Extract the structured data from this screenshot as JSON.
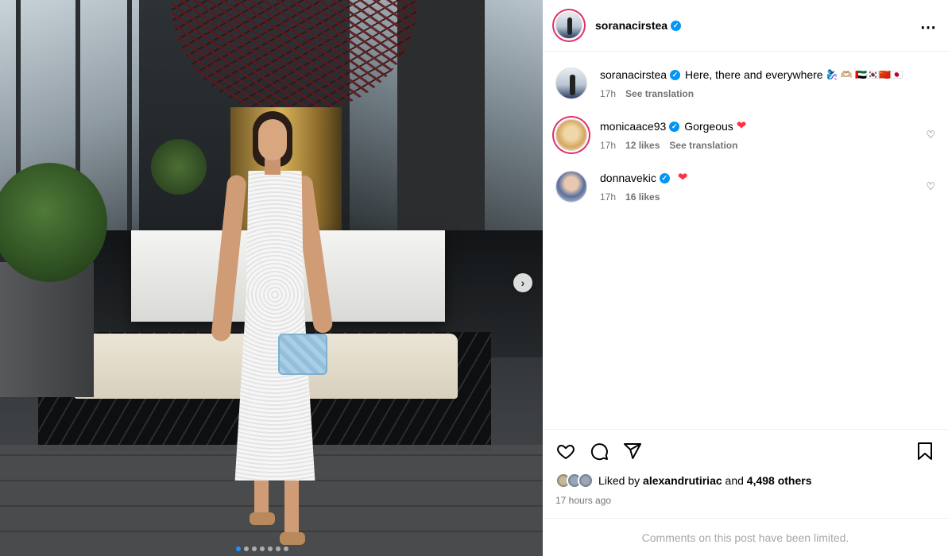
{
  "post": {
    "author": "soranacirstea",
    "verified_mark": "✓",
    "more_icon": "⋯",
    "next_icon": "›",
    "carousel": {
      "total": 7,
      "active_index": 0
    }
  },
  "caption": {
    "username": "soranacirstea",
    "text": "Here, there and everywhere",
    "emojis": "🧞‍♀️ 🫶🏼 🇦🇪🇰🇷🇨🇳🇯🇵",
    "time": "17h",
    "translation": "See translation"
  },
  "comments": [
    {
      "username": "monicaace93",
      "text": "Gorgeous",
      "heart": "❤",
      "time": "17h",
      "likes": "12 likes",
      "translation": "See translation",
      "like_icon": "♡"
    },
    {
      "username": "donnavekic",
      "text": "",
      "heart": "❤",
      "time": "17h",
      "likes": "16 likes",
      "like_icon": "♡"
    }
  ],
  "likes": {
    "prefix": "Liked by",
    "user": "alexandrutiriac",
    "conjunction": "and",
    "others": "4,498 others"
  },
  "timestamp": "17 hours ago",
  "comments_limited": "Comments on this post have been limited.",
  "icons": [
    "heart-icon",
    "comment-icon",
    "share-icon",
    "bookmark-icon"
  ]
}
